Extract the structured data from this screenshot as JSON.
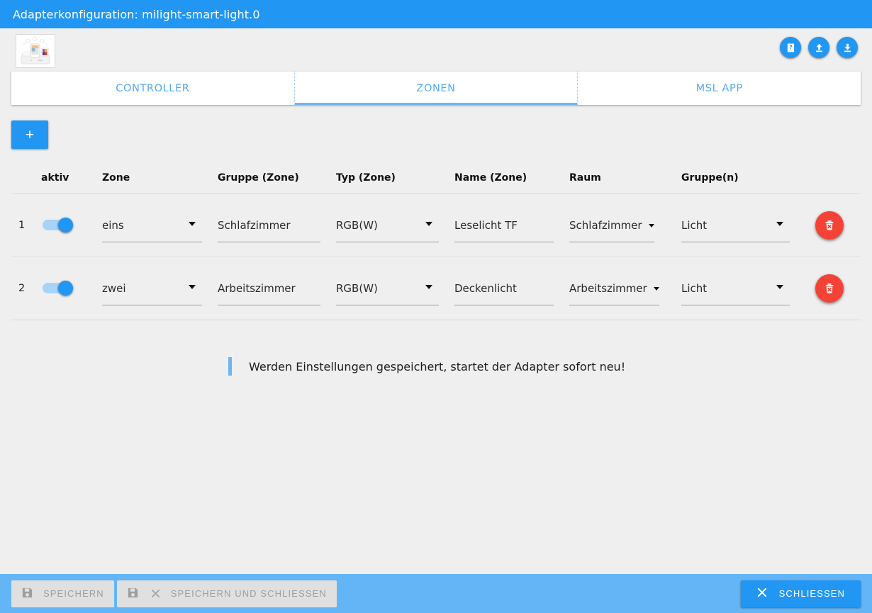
{
  "window": {
    "title": "Adapterkonfiguration: milight-smart-light.0"
  },
  "header": {
    "logo_alt": "milight-smart-light",
    "actions": [
      {
        "name": "help-button",
        "icon": "book-question-icon"
      },
      {
        "name": "upload-button",
        "icon": "upload-icon"
      },
      {
        "name": "download-button",
        "icon": "download-icon"
      }
    ]
  },
  "tabs": [
    {
      "label": "CONTROLLER",
      "active": false
    },
    {
      "label": "ZONEN",
      "active": true
    },
    {
      "label": "MSL APP",
      "active": false
    }
  ],
  "toolbar": {
    "add_label": "+"
  },
  "table": {
    "headers": {
      "index": "",
      "aktiv": "aktiv",
      "zone": "Zone",
      "gruppe_zone": "Gruppe (Zone)",
      "typ_zone": "Typ (Zone)",
      "name_zone": "Name (Zone)",
      "raum": "Raum",
      "gruppen": "Gruppe(n)"
    },
    "rows": [
      {
        "index": "1",
        "aktiv": true,
        "zone": "eins",
        "gruppe_zone": "Schlafzimmer",
        "typ_zone": "RGB(W)",
        "name_zone": "Leselicht TF",
        "raum": "Schlafzimmer",
        "gruppen": "Licht"
      },
      {
        "index": "2",
        "aktiv": true,
        "zone": "zwei",
        "gruppe_zone": "Arbeitszimmer",
        "typ_zone": "RGB(W)",
        "name_zone": "Deckenlicht",
        "raum": "Arbeitszimmer",
        "gruppen": "Licht"
      }
    ]
  },
  "info": {
    "message": "Werden Einstellungen gespeichert, startet der Adapter sofort neu!"
  },
  "footer": {
    "save_label": "SPEICHERN",
    "save_close_label": "SPEICHERN UND SCHLIESSEN",
    "close_label": "SCHLIESSEN"
  },
  "colors": {
    "accent": "#2196f3",
    "titlebar": "#2196f3",
    "footer": "#64b5f6",
    "danger": "#f44336",
    "page_bg": "#efefef",
    "tab_text": "#54a9f5"
  }
}
